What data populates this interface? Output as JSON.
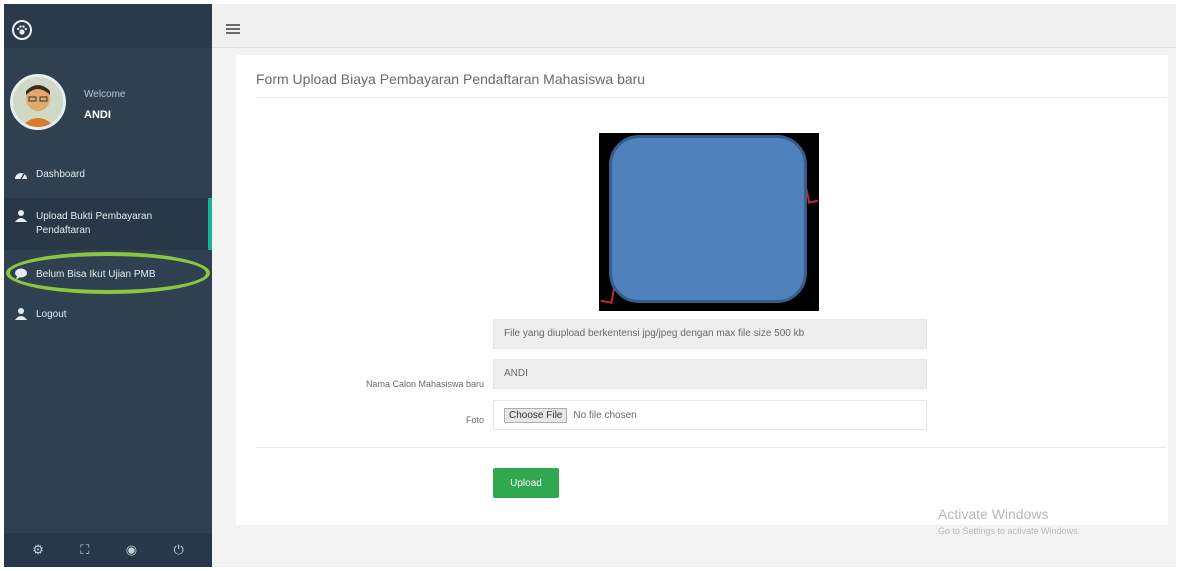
{
  "sidebar": {
    "welcome": "Welcome",
    "username": "ANDI",
    "items": [
      {
        "label": "Dashboard"
      },
      {
        "label": "Upload Bukti Pembayaran Pendaftaran"
      },
      {
        "label": "Belum Bisa Ikut Ujian PMB"
      },
      {
        "label": "Logout"
      }
    ],
    "active_color": "#1ab394",
    "highlight_color": "#8cc63f"
  },
  "form": {
    "title": "Form Upload Biaya Pembayaran Pendaftaran Mahasiswa baru",
    "info_text": "File yang diupload berkentensi jpg/jpeg dengan max file size 500 kb",
    "nama_label": "Nama Calon Mahasiswa baru",
    "nama_value": "ANDI",
    "foto_label": "Foto",
    "choose_file_label": "Choose File",
    "no_file_text": "No file chosen",
    "upload_label": "Upload"
  },
  "watermark": {
    "line1": "Activate Windows",
    "line2": "Go to Settings to activate Windows."
  }
}
